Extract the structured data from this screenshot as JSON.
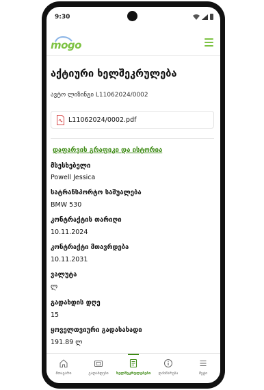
{
  "status_bar": {
    "time": "9:30"
  },
  "app": {
    "logo_text": "mogo",
    "brand_color": "#7cc242",
    "link_color": "#3d8a14"
  },
  "page": {
    "title": "აქტიური ხელშეკრულება",
    "subtitle": "ავტო ლიზინგი L11062024/0002",
    "document": {
      "name": "L11062024/0002.pdf",
      "icon": "pdf-icon"
    },
    "schedule_link": "დაფარვის გრაფიკი და ისტორია"
  },
  "details": [
    {
      "label": "მსესხებელი",
      "value": "Powell Jessica"
    },
    {
      "label": "სატრანსპორტო საშუალება",
      "value": "BMW 530"
    },
    {
      "label": "კონტრაქტის თარიღი",
      "value": "10.11.2024"
    },
    {
      "label": "კონტრაქტი მთავრდება",
      "value": "10.11.2031"
    },
    {
      "label": "ვალუტა",
      "value": "ლ"
    },
    {
      "label": "გადახდის დღე",
      "value": "15"
    },
    {
      "label": "ყოველთვიური გადასახადი",
      "value": "191.89 ლ"
    }
  ],
  "nav": {
    "items": [
      {
        "label": "მთავარი",
        "icon": "home-icon"
      },
      {
        "label": "გადახდები",
        "icon": "wallet-icon"
      },
      {
        "label": "ხელშეკრულებები",
        "icon": "contract-icon",
        "active": true
      },
      {
        "label": "დახმარება",
        "icon": "info-icon"
      },
      {
        "label": "მეტი",
        "icon": "menu-icon"
      }
    ]
  }
}
